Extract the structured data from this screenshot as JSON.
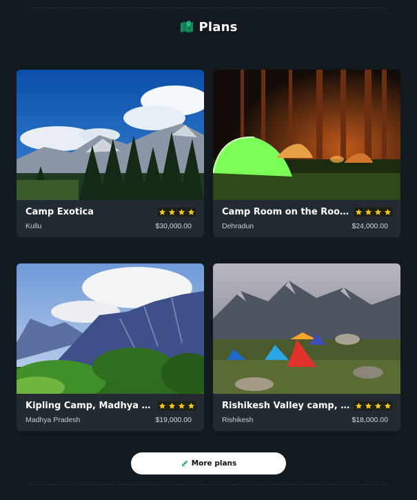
{
  "header": {
    "title": "Plans",
    "icon": "map-icon",
    "icon_color": "#1fa971"
  },
  "cards": [
    {
      "title": "Camp Exotica",
      "location": "Kullu",
      "price": "$30,000.00",
      "rating": 4,
      "image": "mountain-forest-photo"
    },
    {
      "title": "Camp Room on the Roof, ...",
      "location": "Dehradun",
      "price": "$24,000.00",
      "rating": 4,
      "image": "night-tents-photo"
    },
    {
      "title": "Kipling Camp, Madhya Pra...",
      "location": "Madhya Pradesh",
      "price": "$19,000.00",
      "rating": 4,
      "image": "valley-peaks-photo"
    },
    {
      "title": "Rishikesh Valley camp, Ris...",
      "location": "Rishikesh",
      "price": "$18,000.00",
      "rating": 4,
      "image": "mountain-tents-photo"
    }
  ],
  "more_button": {
    "label": "More plans",
    "icon": "rocket-icon"
  },
  "colors": {
    "background": "#121a1f",
    "card": "#232a31",
    "star": "#f5c518",
    "accent": "#1fa971"
  }
}
